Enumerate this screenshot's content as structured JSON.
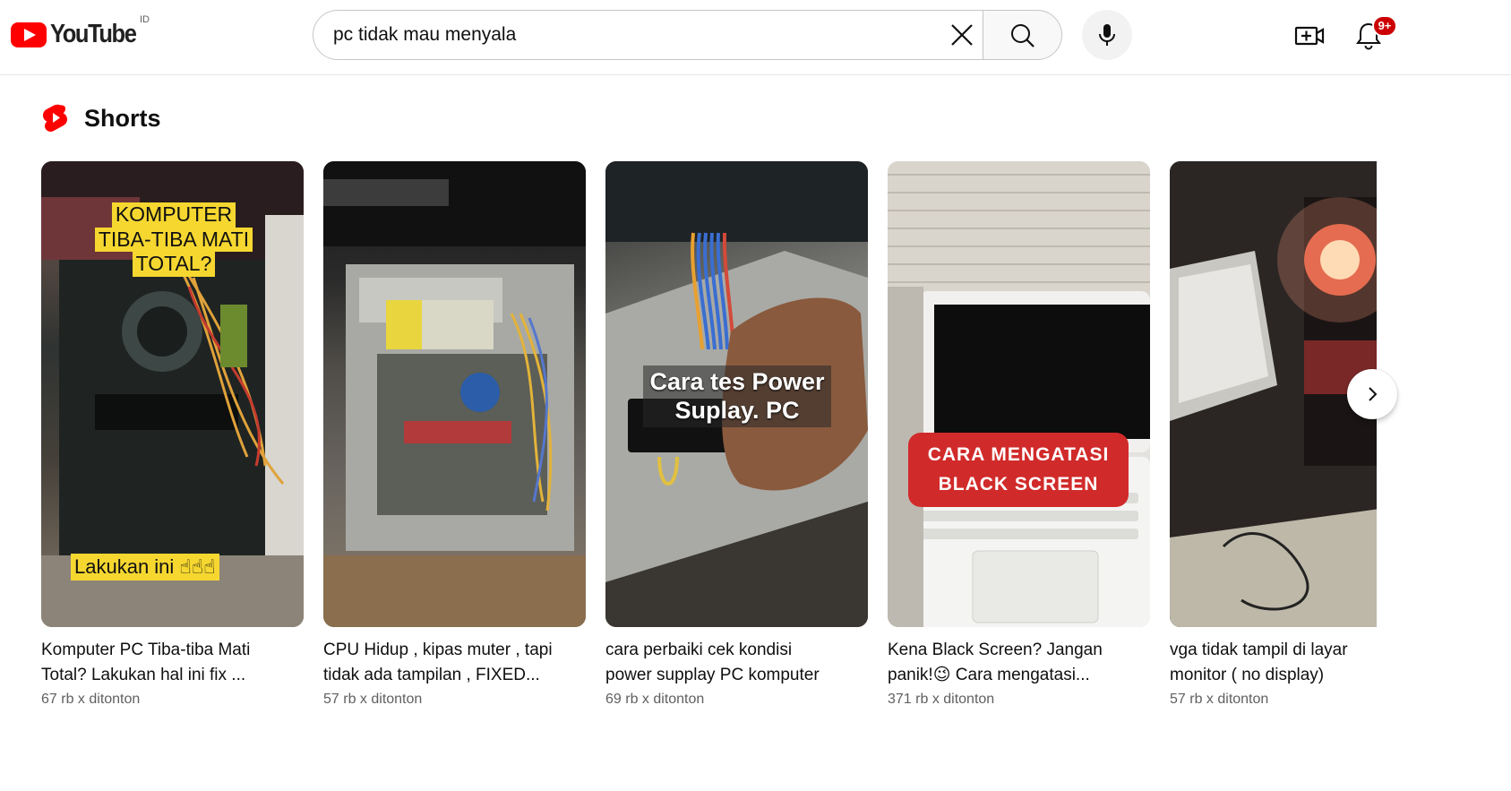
{
  "header": {
    "logo_text": "YouTube",
    "country_code": "ID",
    "search_value": "pc tidak mau menyala",
    "notification_badge": "9+"
  },
  "shorts": {
    "section_title": "Shorts",
    "items": [
      {
        "overlay_lines": [
          "KOMPUTER",
          "TIBA-TIBA MATI",
          "TOTAL?"
        ],
        "overlay_bottom": "Lakukan ini ☝☝☝",
        "title": "Komputer PC Tiba-tiba Mati\nTotal? Lakukan hal ini fix ...",
        "views": "67 rb x ditonton"
      },
      {
        "title": "CPU Hidup , kipas muter , tapi\ntidak ada tampilan , FIXED...",
        "views": "57 rb x ditonton"
      },
      {
        "overlay_text": "Cara tes Power\nSuplay. PC",
        "title": "cara perbaiki cek kondisi\npower supplay PC komputer",
        "views": "69 rb x ditonton"
      },
      {
        "overlay_text": "CARA MENGATASI\nBLACK SCREEN",
        "title": "Kena Black Screen? Jangan\npanik!😉 Cara mengatasi...",
        "views": "371 rb x ditonton"
      },
      {
        "title": "vga tidak tampil di layar\nmonitor ( no display)",
        "views": "57 rb x ditonton"
      }
    ]
  },
  "colors": {
    "brand_red": "#ff0000",
    "text_primary": "#0f0f0f",
    "text_secondary": "#606060",
    "overlay_yellow": "#f6d730",
    "overlay_red": "#d12a2a"
  }
}
